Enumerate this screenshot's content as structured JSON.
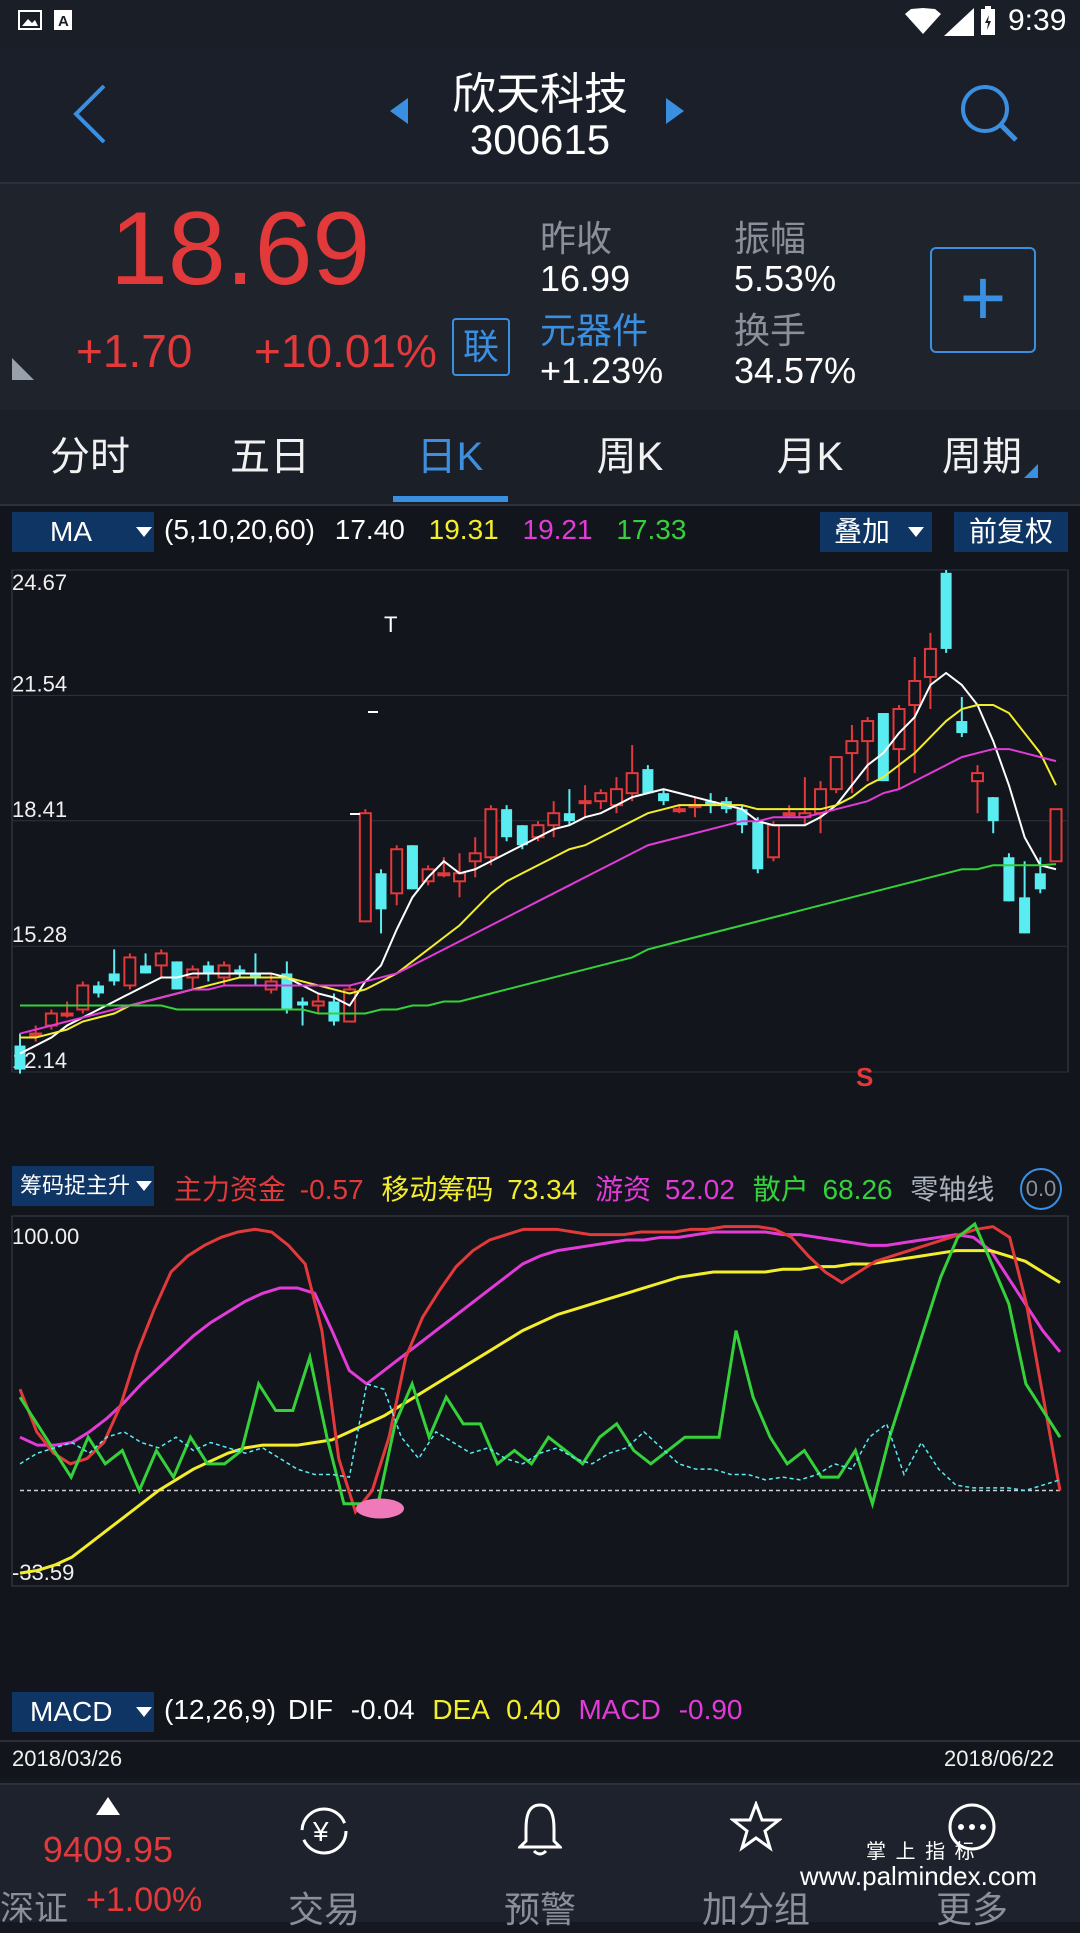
{
  "status_bar": {
    "time": "9:39",
    "icons": [
      "image-icon",
      "font-icon",
      "wifi-icon",
      "signal-icon",
      "battery-icon"
    ]
  },
  "header": {
    "stock_name": "欣天科技",
    "stock_code": "300615",
    "back_icon": "chevron-left-icon",
    "prev_icon": "triangle-left-icon",
    "next_icon": "triangle-right-icon",
    "search_icon": "search-icon"
  },
  "quote": {
    "price": "18.69",
    "change": "+1.70",
    "change_pct": "+10.01%",
    "link_badge": "联",
    "prev_close_label": "昨收",
    "prev_close_value": "16.99",
    "amplitude_label": "振幅",
    "amplitude_value": "5.53%",
    "sector_label": "元器件",
    "sector_value": "+1.23%",
    "turnover_label": "换手",
    "turnover_value": "34.57%",
    "add_button": "+"
  },
  "tabs": {
    "items": [
      "分时",
      "五日",
      "日K",
      "周K",
      "月K",
      "周期"
    ],
    "active": "日K"
  },
  "ma_bar": {
    "indicator": "MA",
    "params": "(5,10,20,60)",
    "ma5": "17.40",
    "ma10": "19.31",
    "ma20": "19.21",
    "ma60": "17.33",
    "overlay": "叠加",
    "adjust": "前复权"
  },
  "price_axis": {
    "labels": [
      "24.67",
      "21.54",
      "18.41",
      "15.28",
      "12.14"
    ]
  },
  "indicator_bar": {
    "indicator": "筹码捉主升",
    "main_label": "主力资金",
    "main_value": "-0.57",
    "move_label": "移动筹码",
    "move_value": "73.34",
    "hot_label": "游资",
    "hot_value": "52.02",
    "retail_label": "散户",
    "retail_value": "68.26",
    "zero_label": "零轴线",
    "zero_value": "0.0"
  },
  "indicator_axis": {
    "top": "100.00",
    "bottom": "-33.59"
  },
  "macd_bar": {
    "indicator": "MACD",
    "params": "(12,26,9)",
    "dif_label": "DIF",
    "dif_value": "-0.04",
    "dea_label": "DEA",
    "dea_value": "0.40",
    "macd_label": "MACD",
    "macd_value": "-0.90"
  },
  "date_range": {
    "start": "2018/03/26",
    "end": "2018/06/22"
  },
  "chart_marks": {
    "t_mark": "T",
    "s_mark": "S"
  },
  "bottom_nav": {
    "index_value": "9409.95",
    "index_name": "深证",
    "index_change": "+1.00%",
    "items": [
      "交易",
      "预警",
      "加分组",
      "更多"
    ]
  },
  "watermark": {
    "line1": "掌 上 指 标",
    "line2": "www.palmindex.com"
  },
  "colors": {
    "red": "#e2393b",
    "cyan": "#59ecf1",
    "yellow": "#f3ee2c",
    "magenta": "#e23bd8",
    "green": "#35d13a",
    "blue_accent": "#3b8fe0"
  },
  "chart_data": {
    "type": "candlestick",
    "ylim": [
      12.14,
      24.67
    ],
    "candles": [
      [
        12.8,
        13.1,
        12.1,
        12.2
      ],
      [
        13.1,
        13.3,
        12.9,
        13.1
      ],
      [
        13.3,
        13.7,
        13.2,
        13.6
      ],
      [
        13.6,
        13.9,
        13.5,
        13.6
      ],
      [
        13.7,
        14.4,
        13.6,
        14.3
      ],
      [
        14.3,
        14.4,
        14.0,
        14.1
      ],
      [
        14.6,
        15.2,
        14.3,
        14.4
      ],
      [
        14.3,
        15.1,
        14.2,
        15.0
      ],
      [
        14.8,
        15.1,
        14.6,
        14.6
      ],
      [
        14.8,
        15.2,
        14.5,
        15.1
      ],
      [
        14.9,
        14.9,
        14.2,
        14.2
      ],
      [
        14.5,
        14.8,
        14.2,
        14.7
      ],
      [
        14.8,
        14.9,
        14.4,
        14.6
      ],
      [
        14.5,
        14.9,
        14.3,
        14.8
      ],
      [
        14.7,
        14.8,
        14.5,
        14.6
      ],
      [
        14.6,
        15.1,
        14.3,
        14.5
      ],
      [
        14.2,
        14.6,
        14.1,
        14.4
      ],
      [
        14.6,
        14.9,
        13.6,
        13.7
      ],
      [
        13.9,
        14.0,
        13.3,
        13.8
      ],
      [
        13.8,
        14.1,
        13.6,
        13.9
      ],
      [
        13.9,
        14.1,
        13.3,
        13.4
      ],
      [
        13.4,
        14.3,
        13.4,
        14.2
      ],
      [
        15.9,
        18.7,
        15.9,
        18.6
      ],
      [
        17.1,
        17.2,
        15.6,
        16.2
      ],
      [
        16.6,
        17.8,
        16.3,
        17.7
      ],
      [
        17.8,
        17.8,
        16.7,
        16.7
      ],
      [
        16.9,
        17.3,
        16.8,
        17.2
      ],
      [
        17.1,
        17.5,
        17.0,
        17.1
      ],
      [
        16.9,
        17.6,
        16.5,
        17.1
      ],
      [
        17.4,
        18.0,
        17.0,
        17.6
      ],
      [
        17.5,
        18.8,
        17.3,
        18.7
      ],
      [
        18.7,
        18.8,
        17.9,
        18.0
      ],
      [
        18.3,
        18.3,
        17.7,
        17.8
      ],
      [
        18.0,
        18.4,
        17.9,
        18.3
      ],
      [
        18.3,
        18.9,
        18.0,
        18.6
      ],
      [
        18.6,
        19.2,
        18.3,
        18.4
      ],
      [
        18.9,
        19.3,
        18.5,
        18.9
      ],
      [
        18.9,
        19.2,
        18.7,
        19.1
      ],
      [
        18.8,
        19.5,
        18.6,
        19.2
      ],
      [
        19.1,
        20.3,
        18.9,
        19.6
      ],
      [
        19.7,
        19.8,
        19.1,
        19.1
      ],
      [
        19.1,
        19.2,
        18.8,
        18.9
      ],
      [
        18.7,
        18.8,
        18.6,
        18.7
      ],
      [
        18.8,
        19.0,
        18.5,
        18.8
      ],
      [
        18.9,
        19.1,
        18.6,
        18.8
      ],
      [
        18.9,
        19.0,
        18.6,
        18.7
      ],
      [
        18.7,
        18.8,
        18.1,
        18.3
      ],
      [
        18.4,
        18.5,
        17.1,
        17.2
      ],
      [
        17.5,
        18.4,
        17.4,
        18.3
      ],
      [
        18.6,
        18.8,
        18.5,
        18.6
      ],
      [
        18.5,
        19.5,
        18.3,
        18.6
      ],
      [
        18.6,
        19.4,
        18.1,
        19.2
      ],
      [
        19.2,
        20.0,
        19.1,
        20.0
      ],
      [
        20.1,
        20.8,
        19.1,
        20.4
      ],
      [
        20.4,
        21.0,
        19.4,
        20.9
      ],
      [
        21.1,
        21.1,
        19.4,
        19.4
      ],
      [
        20.2,
        21.3,
        19.2,
        21.2
      ],
      [
        21.3,
        22.5,
        19.6,
        21.9
      ],
      [
        22.0,
        23.1,
        21.2,
        22.7
      ],
      [
        24.6,
        24.67,
        22.6,
        22.7
      ],
      [
        20.9,
        21.5,
        20.5,
        20.6
      ],
      [
        19.4,
        19.8,
        18.6,
        19.6
      ],
      [
        19.0,
        19.0,
        18.1,
        18.4
      ],
      [
        17.5,
        17.6,
        16.4,
        16.4
      ],
      [
        16.5,
        17.4,
        15.6,
        15.6
      ],
      [
        17.1,
        17.5,
        16.6,
        16.7
      ],
      [
        17.4,
        18.7,
        17.4,
        18.7
      ]
    ],
    "ma5": [
      12.6,
      12.8,
      13.0,
      13.3,
      13.5,
      13.7,
      13.9,
      14.1,
      14.3,
      14.5,
      14.5,
      14.6,
      14.6,
      14.6,
      14.6,
      14.6,
      14.6,
      14.5,
      14.3,
      14.1,
      14.0,
      13.8,
      14.4,
      14.8,
      15.7,
      16.5,
      17.0,
      17.4,
      17.1,
      17.2,
      17.4,
      17.6,
      17.8,
      18.0,
      18.2,
      18.3,
      18.5,
      18.6,
      18.8,
      19.0,
      19.1,
      19.2,
      19.1,
      19.0,
      18.9,
      18.8,
      18.7,
      18.4,
      18.3,
      18.3,
      18.3,
      18.5,
      18.8,
      19.3,
      19.8,
      20.1,
      20.6,
      21.0,
      21.8,
      22.1,
      21.8,
      21.3,
      20.4,
      19.3,
      18.0,
      17.3,
      17.2
    ],
    "ma10": [
      13.0,
      13.0,
      13.1,
      13.2,
      13.4,
      13.5,
      13.6,
      13.8,
      13.9,
      14.0,
      14.1,
      14.2,
      14.3,
      14.4,
      14.5,
      14.5,
      14.5,
      14.5,
      14.4,
      14.3,
      14.2,
      14.1,
      14.2,
      14.4,
      14.6,
      14.9,
      15.2,
      15.5,
      15.8,
      16.2,
      16.6,
      16.9,
      17.1,
      17.3,
      17.5,
      17.7,
      17.8,
      18.0,
      18.2,
      18.4,
      18.6,
      18.7,
      18.8,
      18.8,
      18.8,
      18.8,
      18.8,
      18.7,
      18.7,
      18.7,
      18.7,
      18.7,
      18.8,
      19.0,
      19.3,
      19.5,
      19.8,
      20.1,
      20.5,
      20.9,
      21.2,
      21.3,
      21.3,
      21.1,
      20.6,
      20.1,
      19.3
    ],
    "ma20": [
      13.1,
      13.2,
      13.3,
      13.4,
      13.5,
      13.6,
      13.7,
      13.8,
      13.9,
      14.0,
      14.1,
      14.2,
      14.2,
      14.3,
      14.3,
      14.3,
      14.3,
      14.3,
      14.3,
      14.3,
      14.3,
      14.3,
      14.4,
      14.5,
      14.6,
      14.8,
      15.0,
      15.2,
      15.4,
      15.6,
      15.8,
      16.0,
      16.2,
      16.4,
      16.6,
      16.8,
      17.0,
      17.2,
      17.4,
      17.6,
      17.8,
      17.9,
      18.0,
      18.1,
      18.2,
      18.3,
      18.4,
      18.4,
      18.5,
      18.5,
      18.5,
      18.6,
      18.7,
      18.8,
      18.9,
      19.1,
      19.2,
      19.4,
      19.6,
      19.8,
      20.0,
      20.1,
      20.2,
      20.2,
      20.1,
      20.0,
      19.9
    ],
    "ma60": [
      13.8,
      13.8,
      13.8,
      13.8,
      13.8,
      13.8,
      13.8,
      13.8,
      13.8,
      13.8,
      13.7,
      13.7,
      13.7,
      13.7,
      13.7,
      13.7,
      13.7,
      13.7,
      13.7,
      13.6,
      13.6,
      13.6,
      13.6,
      13.7,
      13.7,
      13.8,
      13.8,
      13.9,
      13.9,
      14.0,
      14.1,
      14.2,
      14.3,
      14.4,
      14.5,
      14.6,
      14.7,
      14.8,
      14.9,
      15.0,
      15.2,
      15.3,
      15.4,
      15.5,
      15.6,
      15.7,
      15.8,
      15.9,
      16.0,
      16.1,
      16.2,
      16.3,
      16.4,
      16.5,
      16.6,
      16.7,
      16.8,
      16.9,
      17.0,
      17.1,
      17.2,
      17.2,
      17.3,
      17.3,
      17.3,
      17.3,
      17.33
    ],
    "indicator": {
      "ylim": [
        -33.59,
        100
      ],
      "main_fund": [
        38,
        22,
        14,
        10,
        12,
        18,
        32,
        52,
        68,
        82,
        88,
        92,
        95,
        97,
        98,
        97,
        92,
        85,
        60,
        12,
        -8,
        0,
        20,
        50,
        65,
        75,
        84,
        90,
        94,
        96,
        98,
        98,
        98,
        97,
        96,
        96,
        96,
        97,
        97,
        97,
        98,
        98,
        99,
        99,
        99,
        98,
        95,
        88,
        82,
        78,
        82,
        86,
        88,
        90,
        92,
        94,
        96,
        98,
        99,
        95,
        70,
        35,
        0
      ],
      "move_chips": [
        -31,
        -30,
        -28,
        -25,
        -20,
        -15,
        -10,
        -5,
        0,
        4,
        8,
        11,
        14,
        16,
        17,
        17,
        17,
        18,
        19,
        22,
        25,
        28,
        32,
        36,
        40,
        44,
        48,
        52,
        56,
        60,
        63,
        66,
        68,
        70,
        72,
        74,
        76,
        78,
        80,
        81,
        82,
        82,
        82,
        82,
        83,
        83,
        84,
        84,
        85,
        85,
        86,
        87,
        88,
        89,
        90,
        90,
        90,
        88,
        86,
        82,
        78
      ],
      "hot_money": [
        20,
        17,
        17,
        18,
        22,
        27,
        33,
        40,
        46,
        52,
        58,
        63,
        67,
        71,
        74,
        76,
        76,
        74,
        60,
        45,
        40,
        45,
        50,
        55,
        60,
        65,
        70,
        75,
        80,
        85,
        88,
        90,
        91,
        92,
        93,
        94,
        94,
        95,
        95,
        96,
        97,
        97,
        97,
        97,
        96,
        96,
        95,
        94,
        93,
        92,
        92,
        93,
        94,
        95,
        96,
        95,
        90,
        80,
        70,
        60,
        52
      ],
      "retail": [
        35,
        25,
        15,
        5,
        20,
        10,
        15,
        0,
        15,
        5,
        20,
        10,
        10,
        15,
        40,
        30,
        30,
        50,
        20,
        -5,
        -5,
        -5,
        25,
        40,
        20,
        35,
        25,
        25,
        10,
        15,
        10,
        20,
        15,
        10,
        20,
        25,
        15,
        10,
        15,
        20,
        20,
        20,
        60,
        35,
        20,
        10,
        15,
        5,
        5,
        15,
        -5,
        20,
        40,
        60,
        80,
        95,
        100,
        85,
        70,
        40,
        30,
        20
      ],
      "zero": 0
    }
  }
}
